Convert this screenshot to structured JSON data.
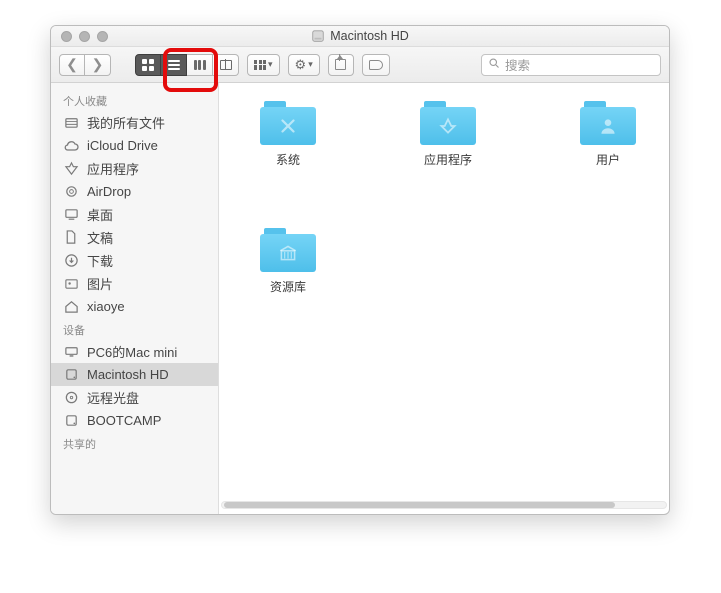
{
  "window": {
    "title": "Macintosh HD"
  },
  "toolbar": {
    "search_placeholder": "搜索"
  },
  "sidebar": {
    "sections": [
      {
        "header": "个人收藏",
        "items": [
          {
            "label": "我的所有文件",
            "icon": "all-files"
          },
          {
            "label": "iCloud Drive",
            "icon": "cloud"
          },
          {
            "label": "应用程序",
            "icon": "apps"
          },
          {
            "label": "AirDrop",
            "icon": "airdrop"
          },
          {
            "label": "桌面",
            "icon": "desktop"
          },
          {
            "label": "文稿",
            "icon": "documents"
          },
          {
            "label": "下载",
            "icon": "downloads"
          },
          {
            "label": "图片",
            "icon": "pictures"
          },
          {
            "label": "xiaoye",
            "icon": "home"
          }
        ]
      },
      {
        "header": "设备",
        "items": [
          {
            "label": "PC6的Mac mini",
            "icon": "computer"
          },
          {
            "label": "Macintosh HD",
            "icon": "hdd",
            "selected": true
          },
          {
            "label": "远程光盘",
            "icon": "disc"
          },
          {
            "label": "BOOTCAMP",
            "icon": "hdd"
          }
        ]
      },
      {
        "header": "共享的",
        "items": []
      }
    ]
  },
  "folders": [
    {
      "label": "系统",
      "symbol": "x"
    },
    {
      "label": "应用程序",
      "symbol": "a"
    },
    {
      "label": "用户",
      "symbol": "user"
    },
    {
      "label": "资源库",
      "symbol": "lib"
    }
  ],
  "colors": {
    "folder": "#5BC8EE",
    "accent": "#e30b0b"
  }
}
